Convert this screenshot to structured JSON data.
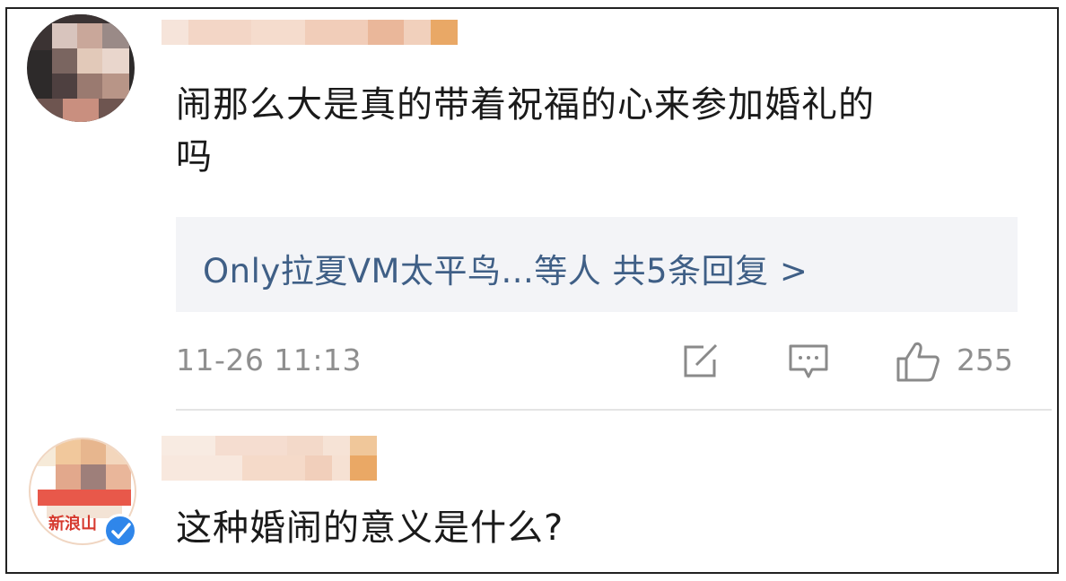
{
  "comments": [
    {
      "text_line1": "闹那么大是真的带着祝福的心来参加婚礼的",
      "text_line2": "吗",
      "reply_summary": "Only拉夏VM太平鸟...等人  共5条回复 >",
      "timestamp": "11-26 11:13",
      "like_count": "255",
      "icons": [
        "share-icon",
        "comment-icon",
        "like-icon"
      ]
    },
    {
      "text": "这种婚闹的意义是什么?",
      "avatar_badge_text": "新浪山",
      "verified_badge": "verified-icon"
    }
  ],
  "colors": {
    "link": "#3f5f86",
    "meta": "#8f8f8f",
    "reply_bg": "#f3f4f7",
    "verified": "#2f86ea"
  }
}
